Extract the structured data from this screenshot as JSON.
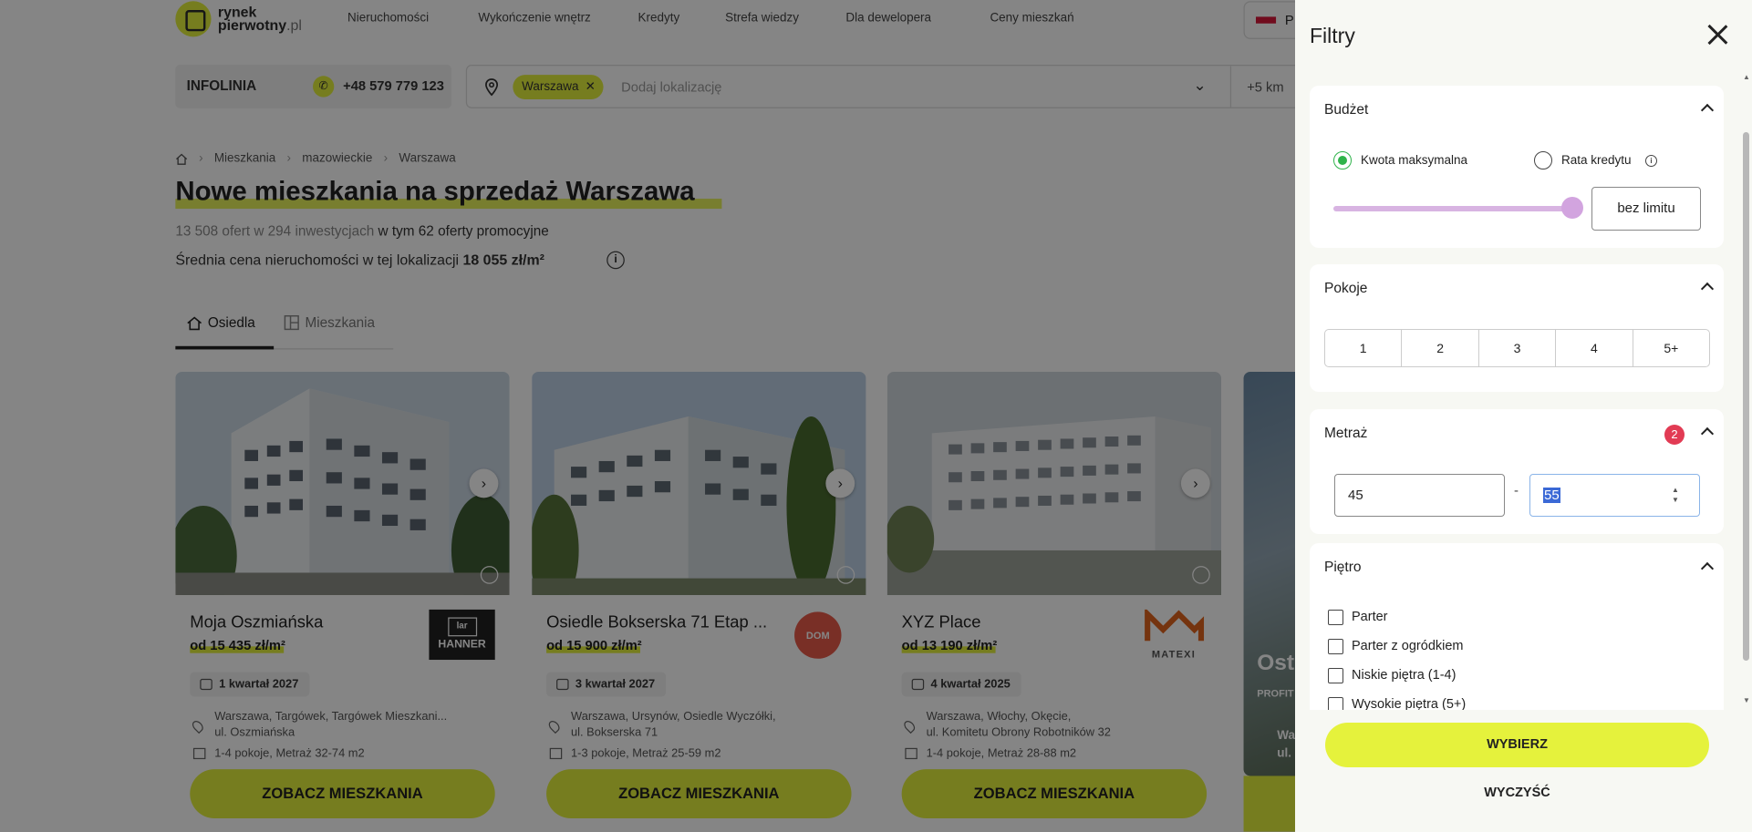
{
  "header": {
    "logo_top": "rynek",
    "logo_bottom": "pierwotny",
    "logo_tld": ".pl",
    "nav": [
      "Nieruchomości",
      "Wykończenie wnętrz",
      "Kredyty",
      "Strefa wiedzy",
      "Dla dewelopera",
      "Ceny mieszkań"
    ],
    "lang": "P"
  },
  "hotline": {
    "label": "INFOLINIA",
    "phone": "+48 579 779 123"
  },
  "search": {
    "chip": "Warszawa",
    "placeholder": "Dodaj lokalizację",
    "radius": "+5 km"
  },
  "breadcrumb": [
    "Mieszkania",
    "mazowieckie",
    "Warszawa"
  ],
  "page": {
    "title": "Nowe mieszkania na sprzedaż Warszawa",
    "offers": "13 508 ofert w 294 inwestycjach",
    "promo": "w tym 62 oferty promocyjne",
    "avg_label": "Średnia cena nieruchomości w tej lokalizacji",
    "avg_value": "18 055 zł/m²",
    "tabs": [
      "Osiedla",
      "Mieszkania"
    ]
  },
  "cards": [
    {
      "name": "Moja Oszmiańska",
      "price": "od 15 435 zł/m²",
      "date": "1 kwartał 2027",
      "addr1": "Warszawa, Targówek, Targówek Mieszkani...",
      "addr2": "ul. Oszmiańska",
      "rooms": "1-4 pokoje, Metraż 32-74 m2",
      "cta": "ZOBACZ MIESZKANIA",
      "dev": "HANNER"
    },
    {
      "name": "Osiedle Bokserska 71 Etap ...",
      "price": "od 15 900 zł/m²",
      "date": "3 kwartał 2027",
      "addr1": "Warszawa, Ursynów, Osiedle Wyczółki,",
      "addr2": "ul. Bokserska 71",
      "rooms": "1-3 pokoje, Metraż 25-59 m2",
      "cta": "ZOBACZ MIESZKANIA",
      "dev": "DOM"
    },
    {
      "name": "XYZ Place",
      "price": "od 13 190 zł/m²",
      "date": "4 kwartał 2025",
      "addr1": "Warszawa, Włochy, Okęcie,",
      "addr2": "ul. Komitetu Obrony Robotników 32",
      "rooms": "1-4 pokoje, Metraż 28-88 m2",
      "cta": "ZOBACZ MIESZKANIA",
      "dev": "MATEXI"
    }
  ],
  "card4": {
    "t1": "Ost",
    "t2": "PROFIT",
    "t3a": "Wa",
    "t3b": "ul."
  },
  "drawer": {
    "title": "Filtry",
    "budget": {
      "title": "Budżet",
      "opt1": "Kwota maksymalna",
      "opt2": "Rata kredytu",
      "value": "bez limitu",
      "selected": "Kwota maksymalna"
    },
    "rooms": {
      "title": "Pokoje",
      "options": [
        "1",
        "2",
        "3",
        "4",
        "5+"
      ]
    },
    "area": {
      "title": "Metraż",
      "badge": "2",
      "min": "45",
      "max": "55"
    },
    "floor": {
      "title": "Piętro",
      "options": [
        "Parter",
        "Parter z ogródkiem",
        "Niskie piętra (1-4)",
        "Wysokie piętra (5+)"
      ]
    },
    "apply": "WYBIERZ",
    "clear": "WYCZYŚĆ"
  },
  "colors": {
    "accent": "#e3f03d",
    "radio": "#2fb34a",
    "badge": "#e23b54",
    "slider": "#d8b4e2"
  }
}
